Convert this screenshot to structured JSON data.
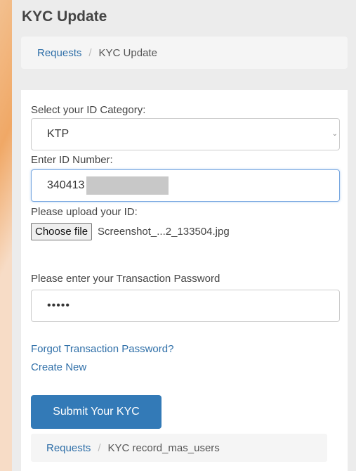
{
  "page": {
    "title": "KYC Update"
  },
  "breadcrumb": {
    "items": [
      "Requests",
      "KYC Update"
    ],
    "separator": "/"
  },
  "form": {
    "id_category_label": "Select your ID Category:",
    "id_category_value": "KTP",
    "id_number_label": "Enter ID Number:",
    "id_number_value": "340413",
    "upload_label": "Please upload your ID:",
    "choose_file_label": "Choose file",
    "file_name": "Screenshot_...2_133504.jpg",
    "password_label": "Please enter your Transaction Password",
    "password_value": "•••••",
    "forgot_link": "Forgot Transaction Password?",
    "create_link": "Create New",
    "submit_label": "Submit Your KYC"
  },
  "breadcrumb2": {
    "items": [
      "Requests",
      "KYC record_mas_users"
    ],
    "separator": "/"
  },
  "icons": {
    "select_chevron": "chevron-down-icon"
  },
  "colors": {
    "accent": "#337ab7",
    "link": "#2f6fa8",
    "background": "#ececec"
  }
}
